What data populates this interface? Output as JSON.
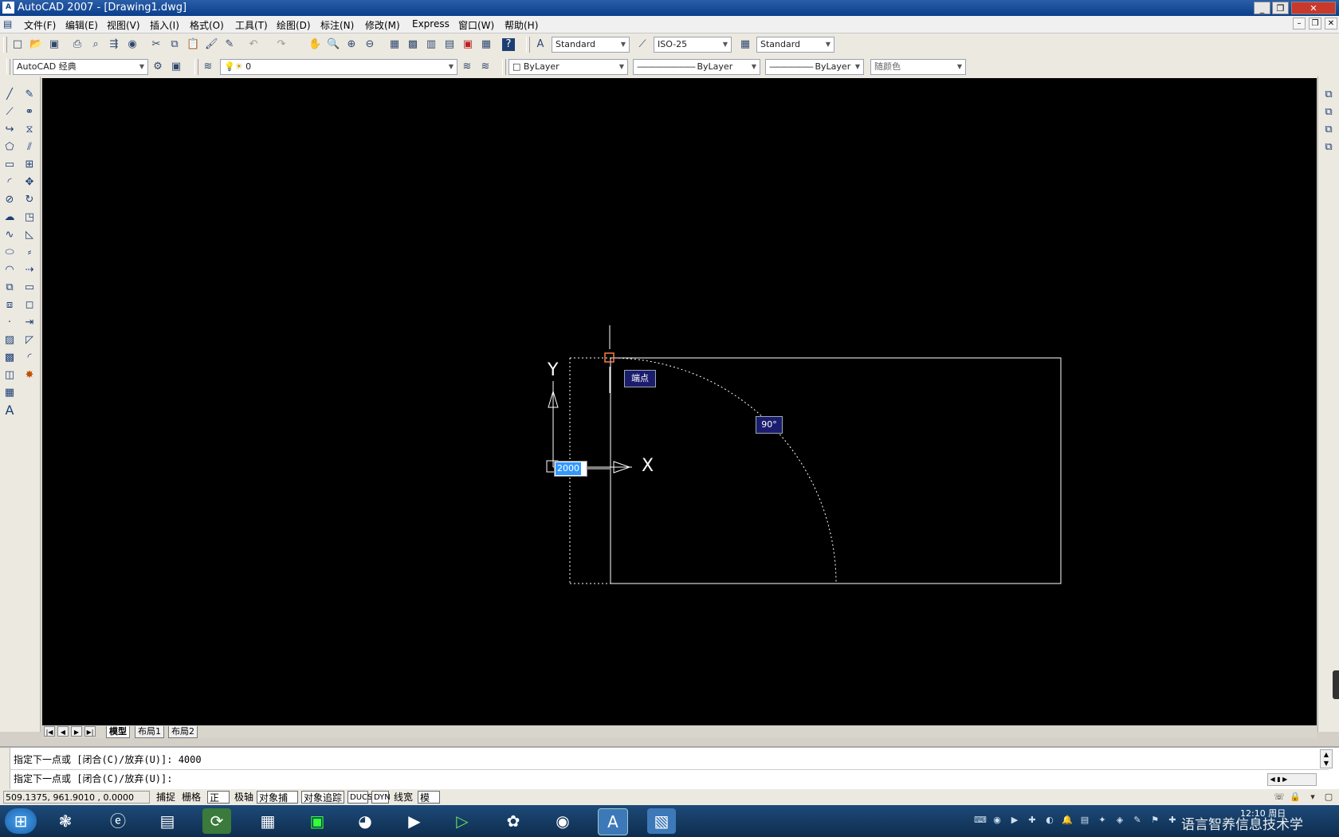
{
  "window": {
    "title": "AutoCAD 2007 - [Drawing1.dwg]",
    "controls": {
      "minimize": "_",
      "restore": "❐",
      "close": "✕"
    },
    "mdi_controls": {
      "minimize": "–",
      "restore": "❐",
      "close": "✕"
    }
  },
  "menu": [
    "文件(F)",
    "编辑(E)",
    "视图(V)",
    "插入(I)",
    "格式(O)",
    "工具(T)",
    "绘图(D)",
    "标注(N)",
    "修改(M)",
    "Express",
    "窗口(W)",
    "帮助(H)"
  ],
  "toolbar1": {
    "text_style": "Standard",
    "dim_style": "ISO-25",
    "table_style": "Standard"
  },
  "toolbar2": {
    "workspace": "AutoCAD 经典",
    "layer": "0",
    "color": "ByLayer",
    "linetype": "ByLayer",
    "lineweight": "ByLayer",
    "plotstyle": "随颜色"
  },
  "canvas": {
    "ucs_x": "X",
    "ucs_y": "Y",
    "tooltip_endpoint": "端点",
    "dyn_angle": "90°",
    "dyn_length": "2000"
  },
  "layout_tabs": [
    "模型",
    "布局1",
    "布局2"
  ],
  "layout_nav": [
    "|◀",
    "◀",
    "▶",
    "▶|"
  ],
  "command": {
    "line1": "指定下一点或 [闭合(C)/放弃(U)]: 4000",
    "line2": "指定下一点或 [闭合(C)/放弃(U)]:"
  },
  "status": {
    "coords": "509.1375,   961.9010  , 0.0000",
    "buttons": [
      {
        "label": "捕捉",
        "on": false
      },
      {
        "label": "栅格",
        "on": false
      },
      {
        "label": "正交",
        "on": true
      },
      {
        "label": "极轴",
        "on": false
      },
      {
        "label": "对象捕捉",
        "on": true
      },
      {
        "label": "对象追踪",
        "on": true
      },
      {
        "label": "DUCS",
        "on": true
      },
      {
        "label": "DYN",
        "on": true
      },
      {
        "label": "线宽",
        "on": false
      },
      {
        "label": "模型",
        "on": true
      }
    ]
  },
  "taskbar": {
    "clock_time": "12:10 周日",
    "watermark": "语言智养信息技术学"
  },
  "colors": {
    "canvas_bg": "#000000",
    "line": "#ffffff",
    "grip": "#ff7f3f",
    "tooltip_bg": "#1c1c6e",
    "dyn_input_bg": "#3399ff"
  }
}
